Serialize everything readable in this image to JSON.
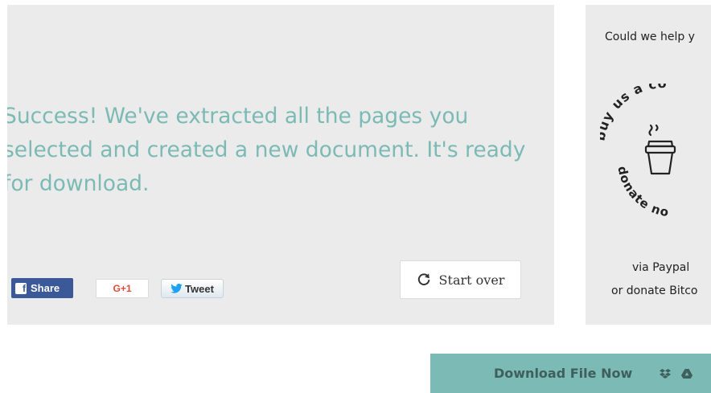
{
  "result": {
    "message": "Success! We've extracted all the pages you selected and created a new document. It's ready for download."
  },
  "social": {
    "share_label": "Share",
    "gplus_label": "G+1",
    "tweet_label": "Tweet"
  },
  "actions": {
    "start_over_label": "Start over",
    "download_label": "Download File Now"
  },
  "donate": {
    "heading": "Could we help y",
    "badge_top": "buy us a co",
    "badge_bottom": "donate no",
    "line1": "via Paypal",
    "line2": "or donate Bitco"
  },
  "icons": {
    "facebook": "facebook-icon",
    "twitter": "twitter-bird-icon",
    "refresh": "refresh-icon",
    "coffee": "coffee-cup-icon",
    "dropbox": "dropbox-icon",
    "google_drive": "google-drive-icon"
  },
  "colors": {
    "accent": "#7bbab5",
    "panel_bg": "#ebebeb",
    "facebook": "#3b5998",
    "gplus": "#dd4b39",
    "twitter": "#1da1f2",
    "download_text": "#3f5f5c"
  }
}
